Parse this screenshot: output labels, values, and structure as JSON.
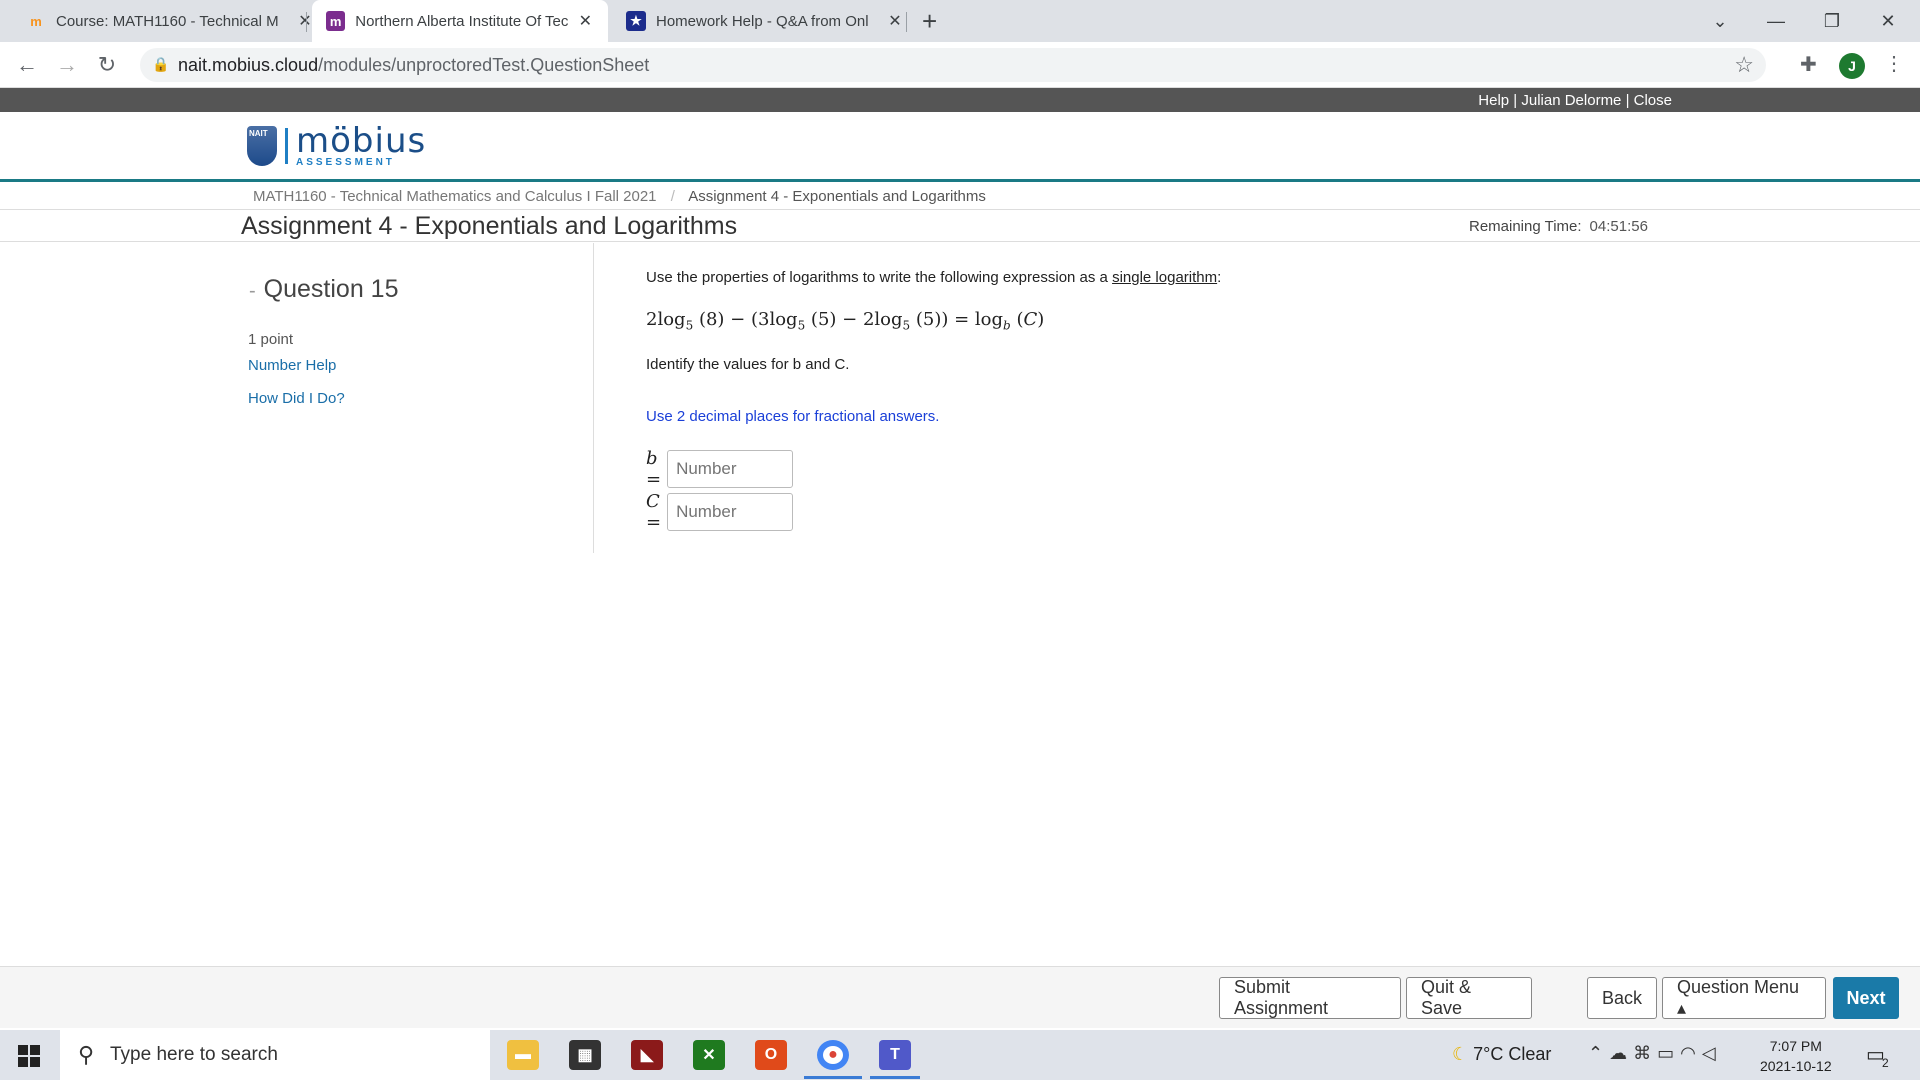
{
  "browser": {
    "tabs": [
      {
        "title": "Course: MATH1160 - Technical M",
        "favicon": "moodle-icon"
      },
      {
        "title": "Northern Alberta Institute Of Tec",
        "favicon": "mobius-icon"
      },
      {
        "title": "Homework Help - Q&A from Onl",
        "favicon": "star-icon"
      }
    ],
    "url_host": "nait.mobius.cloud",
    "url_path": "/modules/unproctoredTest.QuestionSheet",
    "avatar_letter": "J"
  },
  "header": {
    "links": "Help | Julian Delorme | Close",
    "logo_badge": "NAIT",
    "logo_main": "möbius",
    "logo_sub": "ASSESSMENT"
  },
  "breadcrumb": {
    "course": "MATH1160 - Technical Mathematics and Calculus I Fall 2021",
    "separator": "/",
    "current": "Assignment 4 - Exponentials and Logarithms"
  },
  "page": {
    "title": "Assignment 4 - Exponentials and Logarithms",
    "remaining_label": "Remaining Time:",
    "remaining_time": "04:51:56"
  },
  "sidebar": {
    "question_label": "Question 15",
    "points": "1 point",
    "number_help": "Number Help",
    "how_did_i_do": "How Did I Do?"
  },
  "question": {
    "instruction_pre": "Use the properties of logarithms to write the following expression as a ",
    "instruction_link": "single logarithm",
    "instruction_post": ":",
    "identify": "Identify the values for b and C.",
    "hint": "Use 2 decimal places for fractional answers.",
    "answers": [
      {
        "label": "b =",
        "placeholder": "Number"
      },
      {
        "label": "C =",
        "placeholder": "Number"
      }
    ]
  },
  "footer": {
    "submit": "Submit Assignment",
    "quit_save": "Quit & Save",
    "back": "Back",
    "question_menu": "Question Menu ▴",
    "next": "Next"
  },
  "taskbar": {
    "search_placeholder": "Type here to search",
    "weather": "7°C  Clear",
    "time": "7:07 PM",
    "date": "2021-10-12",
    "notifications": "2"
  },
  "colors": {
    "accent": "#1a7aa8",
    "teal_line": "#1a7a85",
    "hint_blue": "#1a3fd8",
    "link_blue": "#1a6ea8"
  }
}
